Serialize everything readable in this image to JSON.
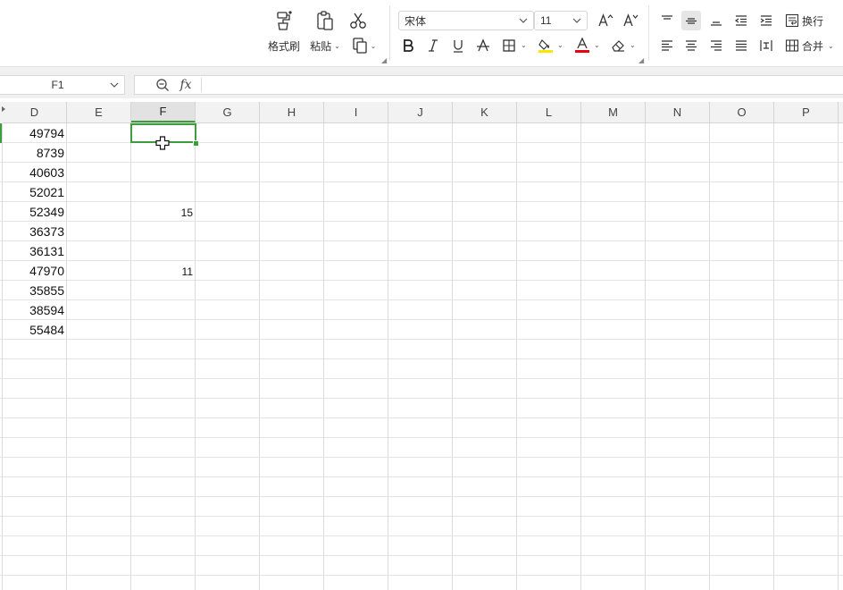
{
  "ribbon": {
    "format_painter_label": "格式刷",
    "paste_label": "粘贴",
    "font_name": "宋体",
    "font_size": "11",
    "wrap_label": "换行",
    "merge_label": "合并",
    "colors": {
      "highlight": "#ffe600",
      "font": "#e60012"
    }
  },
  "formula_bar": {
    "name_box": "F1",
    "fx_label": "fx",
    "formula_value": ""
  },
  "columns": [
    "D",
    "E",
    "F",
    "G",
    "H",
    "I",
    "J",
    "K",
    "L",
    "M",
    "N",
    "O",
    "P"
  ],
  "selected_column": "F",
  "column_d_values": [
    "49794",
    "8739",
    "40603",
    "52021",
    "52349",
    "36373",
    "36131",
    "47970",
    "35855",
    "38594",
    "55484"
  ],
  "column_f_values": [
    "",
    "",
    "",
    "",
    "15",
    "",
    "",
    "11",
    "",
    "",
    ""
  ],
  "accent_color": "#3e9c3e"
}
